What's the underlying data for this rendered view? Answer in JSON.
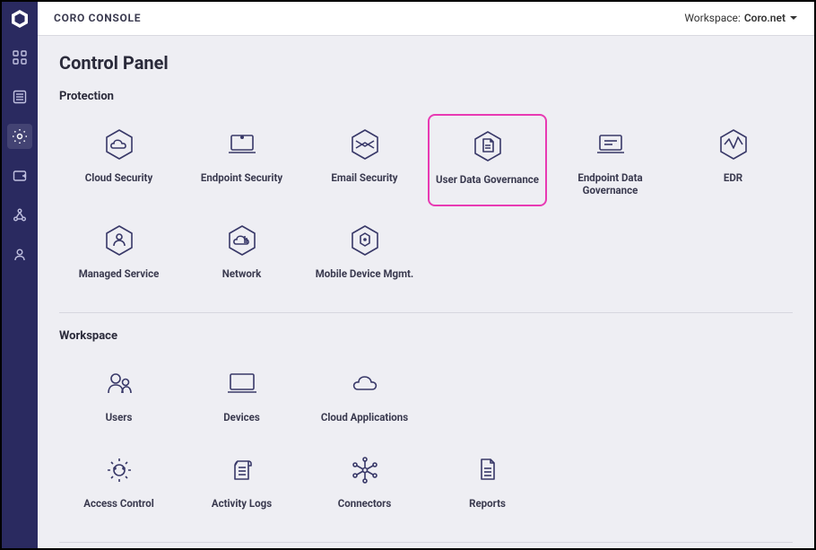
{
  "header": {
    "brand": "CORO CONSOLE",
    "workspace_label": "Workspace:",
    "workspace_name": "Coro.net"
  },
  "page": {
    "title": "Control Panel"
  },
  "sections": {
    "protection": {
      "title": "Protection",
      "items": [
        {
          "label": "Cloud Security"
        },
        {
          "label": "Endpoint Security"
        },
        {
          "label": "Email Security"
        },
        {
          "label": "User Data Governance"
        },
        {
          "label": "Endpoint Data Governance"
        },
        {
          "label": "EDR"
        },
        {
          "label": "Managed Service"
        },
        {
          "label": "Network"
        },
        {
          "label": "Mobile Device Mgmt."
        }
      ]
    },
    "workspace": {
      "title": "Workspace",
      "items": [
        {
          "label": "Users"
        },
        {
          "label": "Devices"
        },
        {
          "label": "Cloud Applications"
        },
        {
          "label": "Access Control"
        },
        {
          "label": "Activity Logs"
        },
        {
          "label": "Connectors"
        },
        {
          "label": "Reports"
        }
      ]
    }
  },
  "colors": {
    "nav_bg": "#2a2a60",
    "highlight": "#e83ab3",
    "stroke": "#383868"
  }
}
